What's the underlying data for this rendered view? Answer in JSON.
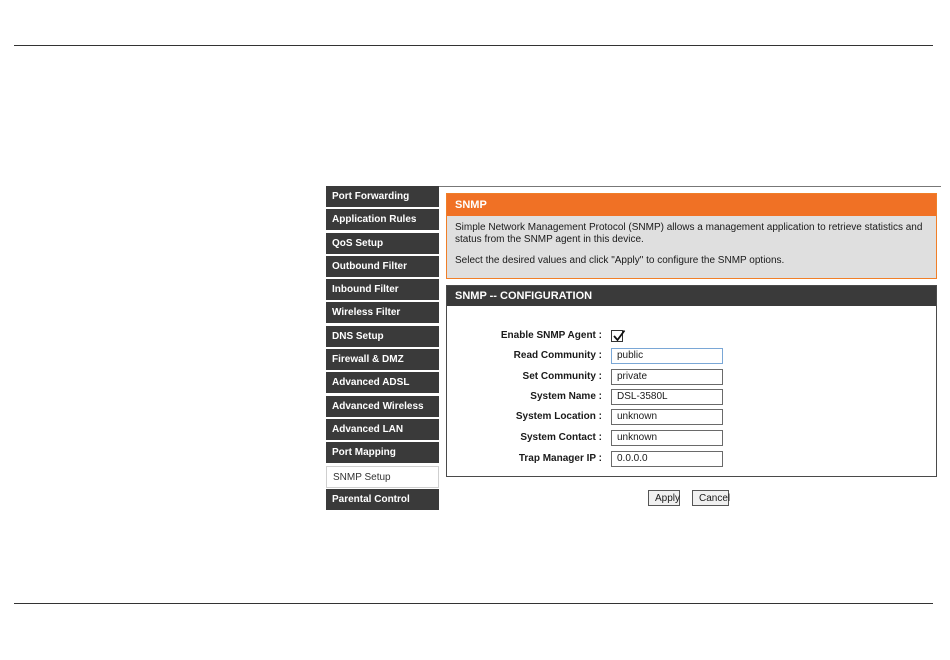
{
  "sidebar": {
    "items": [
      {
        "label": "Port Forwarding"
      },
      {
        "label": "Application Rules"
      },
      {
        "label": "QoS Setup"
      },
      {
        "label": "Outbound Filter"
      },
      {
        "label": "Inbound Filter"
      },
      {
        "label": "Wireless Filter"
      },
      {
        "label": "DNS Setup"
      },
      {
        "label": "Firewall & DMZ"
      },
      {
        "label": "Advanced ADSL"
      },
      {
        "label": "Advanced Wireless"
      },
      {
        "label": "Advanced LAN"
      },
      {
        "label": "Port Mapping"
      },
      {
        "label": "SNMP Setup"
      },
      {
        "label": "Parental Control"
      }
    ],
    "active_index": 12
  },
  "snmp_panel": {
    "title": "SNMP",
    "description": "Simple Network Management Protocol (SNMP) allows a management application to retrieve statistics and status from the SNMP agent in this device.",
    "instruction": "Select the desired values and click \"Apply\" to configure the SNMP options."
  },
  "config": {
    "title": "SNMP -- CONFIGURATION",
    "enable_label": "Enable SNMP Agent :",
    "enable_checked": true,
    "read_community": {
      "label": "Read Community :",
      "value": "public"
    },
    "set_community": {
      "label": "Set Community :",
      "value": "private"
    },
    "system_name": {
      "label": "System Name :",
      "value": "DSL-3580L"
    },
    "system_location": {
      "label": "System Location :",
      "value": "unknown"
    },
    "system_contact": {
      "label": "System Contact :",
      "value": "unknown"
    },
    "trap_manager": {
      "label": "Trap Manager IP :",
      "value": "0.0.0.0"
    }
  },
  "buttons": {
    "apply": "Apply",
    "cancel": "Cancel"
  },
  "colors": {
    "accent": "#f07125",
    "sidebar": "#3a3a3a"
  }
}
